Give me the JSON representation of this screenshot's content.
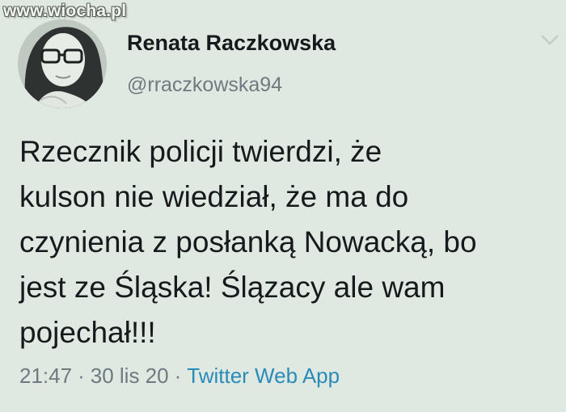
{
  "watermark": "www.wiocha.pl",
  "tweet": {
    "display_name": "Renata Raczkowska",
    "handle": "@rraczkowska94",
    "text": "Rzecznik policji twierdzi, że\nkulson nie wiedział, że ma do\nczynienia z posłanką Nowacką, bo\njest ze Śląska! Ślązacy ale wam\npojechał!!!",
    "time": "21:47",
    "date": "30 lis 20",
    "separator": "·",
    "source_app": "Twitter Web App"
  },
  "icons": {
    "avatar": "profile-photo",
    "menu": "chevron-down-icon"
  },
  "colors": {
    "background": "#dfe9e1",
    "text": "#161a1c",
    "secondary_text": "#6f7a80",
    "link": "#2a8bb9"
  }
}
